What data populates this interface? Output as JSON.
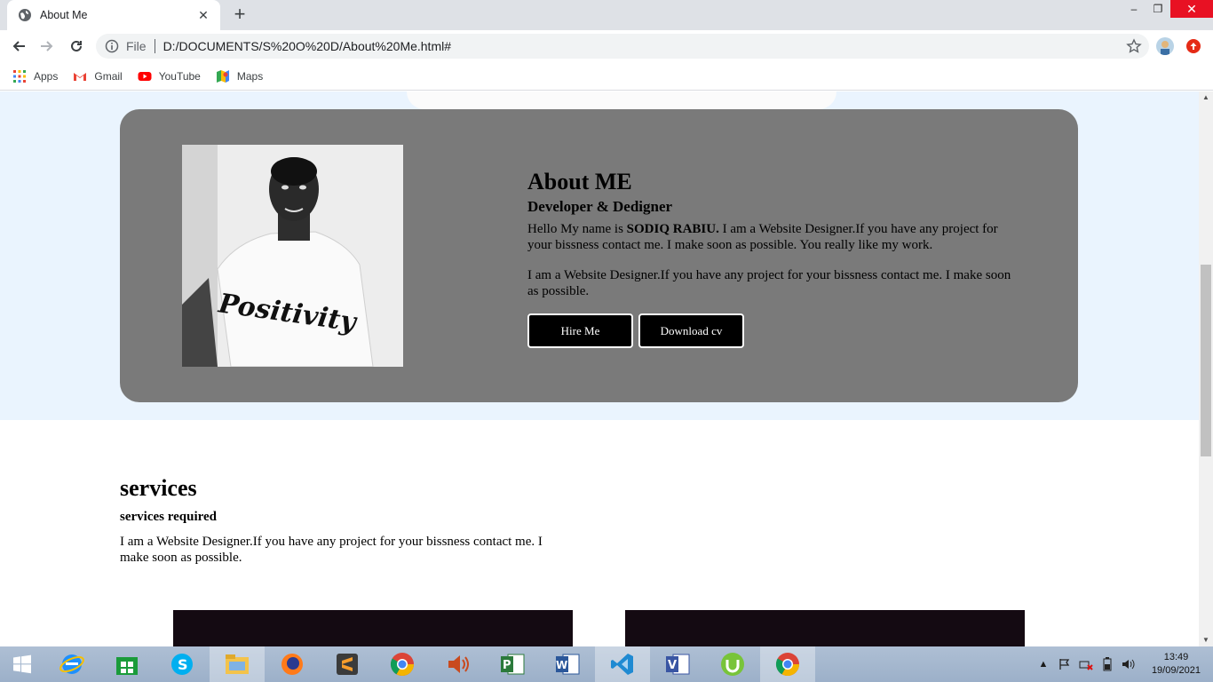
{
  "browser": {
    "tab_title": "About Me",
    "new_tab": "+",
    "scheme_label": "File",
    "url": "D:/DOCUMENTS/S%20O%20D/About%20Me.html#",
    "window_controls": {
      "minimize": "–",
      "maximize": "❐",
      "close": "✕"
    }
  },
  "bookmarks": [
    {
      "label": "Apps",
      "icon": "apps-grid-icon"
    },
    {
      "label": "Gmail",
      "icon": "gmail-icon"
    },
    {
      "label": "YouTube",
      "icon": "youtube-icon"
    },
    {
      "label": "Maps",
      "icon": "maps-icon"
    }
  ],
  "about": {
    "heading": "About ME",
    "subheading": "Developer & Dedigner",
    "intro_before": "Hello My name is ",
    "name": "SODIQ RABIU.",
    "intro_after": " I am a Website Designer.If you have any project for your bissness contact me. I make soon as possible. You really like my work.",
    "paragraph2": "I am a Website Designer.If you have any project for your bissness contact me. I make soon as possible.",
    "hire_label": "Hire Me",
    "download_label": "Download cv",
    "photo_shirt_text": "Positivity"
  },
  "services": {
    "heading": "services",
    "subheading": "services required",
    "text": "I am a Website Designer.If you have any project for your bissness contact me. I make soon as possible."
  },
  "taskbar": {
    "apps": [
      "internet-explorer-icon",
      "store-icon",
      "skype-icon",
      "file-explorer-icon",
      "firefox-icon",
      "sublime-text-icon",
      "chrome-icon",
      "speaker-app-icon",
      "project-icon",
      "word-icon",
      "vscode-icon",
      "visio-icon",
      "utorrent-icon",
      "chrome-active-icon"
    ],
    "time": "13:49",
    "date": "19/09/2021"
  },
  "colors": {
    "about_bg": "#eaf4fe",
    "card_bg": "#7a7a7a",
    "button_bg": "#000000",
    "close_red": "#e81123"
  }
}
